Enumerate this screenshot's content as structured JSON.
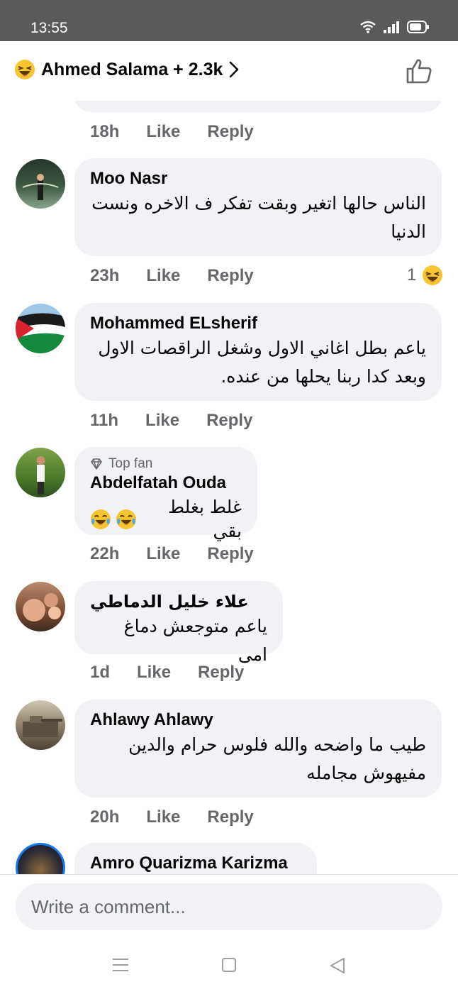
{
  "status_bar": {
    "time": "13:55"
  },
  "header": {
    "reactors_label": "Ahmed Salama + 2.3k"
  },
  "comments": [
    {
      "meta": {
        "time": "18h",
        "like": "Like",
        "reply": "Reply"
      }
    },
    {
      "name": "Moo Nasr",
      "text": "الناس حالها اتغير وبقت تفكر ف الاخره ونست الدنيا",
      "meta": {
        "time": "23h",
        "like": "Like",
        "reply": "Reply"
      },
      "reactions": "1"
    },
    {
      "name": "Mohammed ELsherif",
      "text": "ياعم بطل اغاني الاول وشغل الراقصات الاول وبعد كدا ربنا يحلها من عنده.",
      "meta": {
        "time": "11h",
        "like": "Like",
        "reply": "Reply"
      }
    },
    {
      "badge": "Top fan",
      "name": "Abdelfatah Ouda",
      "text": "غلط بغلط بقي",
      "meta": {
        "time": "22h",
        "like": "Like",
        "reply": "Reply"
      }
    },
    {
      "name": "علاء خليل الدماطي",
      "text": "ياعم متوجعش دماغ امى",
      "meta": {
        "time": "1d",
        "like": "Like",
        "reply": "Reply"
      }
    },
    {
      "name": "Ahlawy Ahlawy",
      "text": "طيب ما واضحه والله فلوس حرام والدين مفيهوش مجامله",
      "meta": {
        "time": "20h",
        "like": "Like",
        "reply": "Reply"
      }
    },
    {
      "name": "Amro Quarizma Karizma"
    }
  ],
  "composer": {
    "placeholder": "Write a comment..."
  },
  "icons": {
    "reaction": "haha-emoji-icon",
    "laugh_cry": "tears-of-joy-emoji-icon",
    "top_fan": "diamond-icon",
    "like": "thumbs-up-icon",
    "chevron": "chevron-right-icon"
  },
  "colors": {
    "bubble": "#f0f2f5",
    "meta_text": "#65676b",
    "statusbar": "#5a5a5a"
  }
}
